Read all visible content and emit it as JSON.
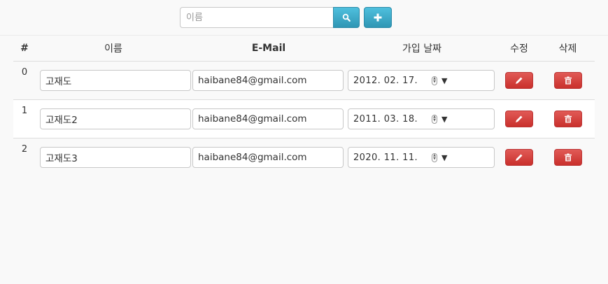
{
  "search": {
    "placeholder": "이름",
    "search_icon": "search-icon",
    "add_icon": "plus-icon"
  },
  "table": {
    "headers": {
      "num": "#",
      "name": "이름",
      "email": "E-Mail",
      "date": "가입 날짜",
      "edit": "수정",
      "delete": "삭제"
    },
    "rows": [
      {
        "index": "0",
        "name": "고재도",
        "email": "haibane84@gmail.com",
        "date": "2012. 02. 17."
      },
      {
        "index": "1",
        "name": "고재도2",
        "email": "haibane84@gmail.com",
        "date": "2011. 03. 18."
      },
      {
        "index": "2",
        "name": "고재도3",
        "email": "haibane84@gmail.com",
        "date": "2020. 11. 11."
      }
    ]
  },
  "colors": {
    "info": "#2f96b4",
    "danger": "#c9302c"
  }
}
